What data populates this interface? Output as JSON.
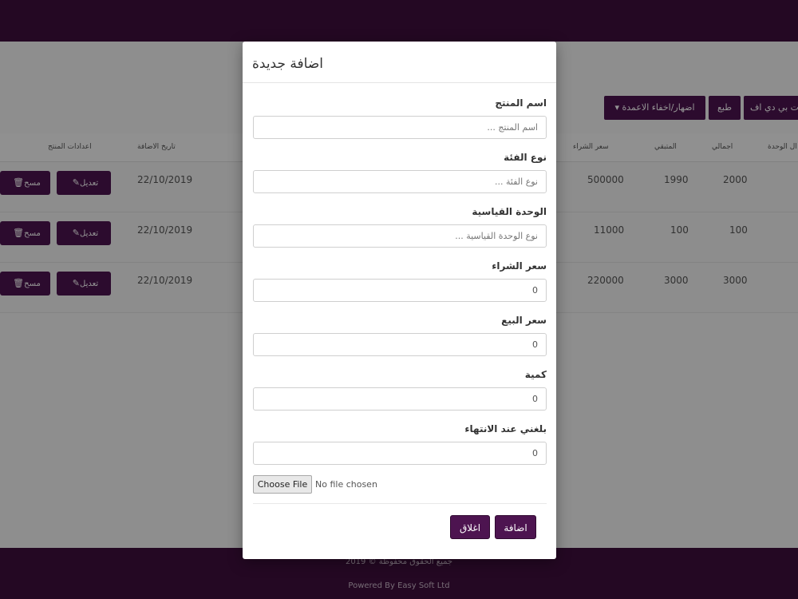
{
  "toolbar": {
    "pdf_label": "ت بي دي اف",
    "print_label": "طبع",
    "columns_label": "اضهار/اخفاء الاعمدة ▾",
    "columns_short": "▾ اضهار/اخفاء الاعمدة"
  },
  "table": {
    "headers": {
      "unit": "ال الوحدة",
      "total": "اجمالي",
      "remaining": "المتبقي",
      "purchase_price": "سعر الشراء",
      "date_added": "تاريخ الاضافة",
      "actions": "اعدادات المنتج"
    },
    "rows": [
      {
        "total": "2000",
        "remaining": "1990",
        "purchase_price": "500000",
        "date": "22/10/2019"
      },
      {
        "total": "100",
        "remaining": "100",
        "purchase_price": "11000",
        "date": "22/10/2019"
      },
      {
        "total": "3000",
        "remaining": "3000",
        "purchase_price": "220000",
        "date": "22/10/2019"
      }
    ],
    "edit_label": "تعديل",
    "delete_label": "مسح"
  },
  "footer": {
    "copyright": "جميع الحقوق محفوظة © 2019",
    "powered": "Powered By Easy Soft Ltd"
  },
  "modal": {
    "title": "اضافة جديدة",
    "fields": {
      "product_name": {
        "label": "اسم المنتج",
        "placeholder": "اسم المنتج ...",
        "value": ""
      },
      "category": {
        "label": "نوع الفئة",
        "placeholder": "نوع الفئة ...",
        "value": ""
      },
      "unit": {
        "label": "الوحدة القياسية",
        "placeholder": "نوع الوحدة القياسية ...",
        "value": ""
      },
      "purchase_price": {
        "label": "سعر الشراء",
        "value": "0"
      },
      "sale_price": {
        "label": "سعر البيع",
        "value": "0"
      },
      "quantity": {
        "label": "كمية",
        "value": "0"
      },
      "alert": {
        "label": "بلغني عند الانتهاء",
        "value": "0"
      }
    },
    "file": {
      "button_label": "Choose File",
      "status": "No file chosen"
    },
    "add_label": "اضافة",
    "close_label": "اغلاق"
  },
  "colors": {
    "primary": "#4d1450",
    "topbar": "#3e0f3d"
  }
}
